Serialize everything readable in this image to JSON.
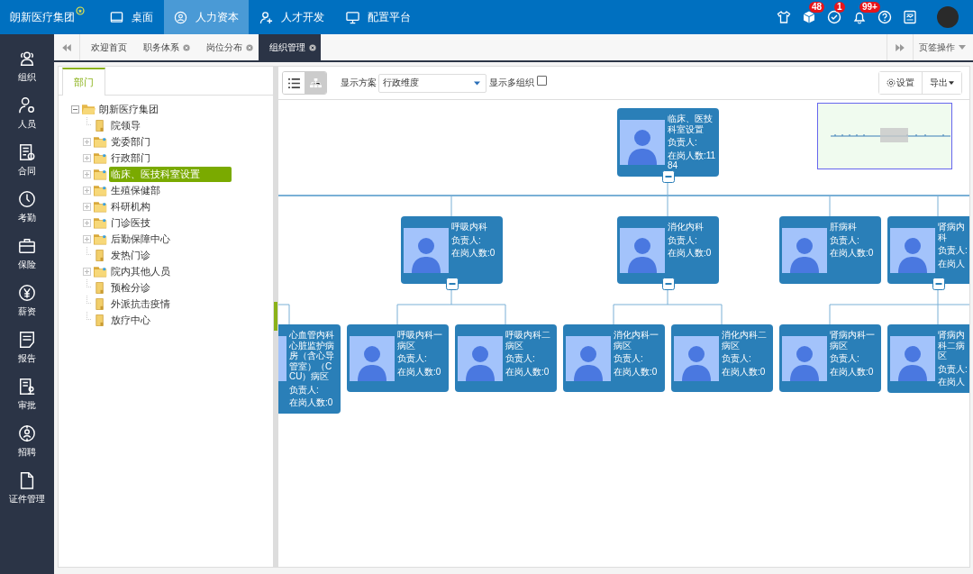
{
  "header": {
    "logo": "朗新医疗集团",
    "nav": [
      {
        "label": "桌面",
        "selected": false
      },
      {
        "label": "人力资本",
        "selected": true
      },
      {
        "label": "人才开发",
        "selected": false
      },
      {
        "label": "配置平台",
        "selected": false
      }
    ],
    "icons": [
      {
        "kind": "shirt"
      },
      {
        "kind": "cube",
        "badge": "48"
      },
      {
        "kind": "check",
        "badge": "1"
      },
      {
        "kind": "bell",
        "badge": "99+"
      },
      {
        "kind": "help"
      },
      {
        "kind": "report"
      },
      {
        "kind": "avatar"
      }
    ]
  },
  "sidebar": [
    "组织",
    "人员",
    "合同",
    "考勤",
    "保险",
    "薪资",
    "报告",
    "审批",
    "招聘",
    "证件管理"
  ],
  "tabs": {
    "items": [
      {
        "label": "欢迎首页",
        "closable": false,
        "selected": false
      },
      {
        "label": "职务体系",
        "closable": true,
        "selected": false
      },
      {
        "label": "岗位分布",
        "closable": true,
        "selected": false
      },
      {
        "label": "组织管理",
        "closable": true,
        "selected": true
      }
    ],
    "menu": "页签操作"
  },
  "tree": {
    "tab": "部门",
    "root": {
      "label": "朗新医疗集团",
      "expanded": true,
      "selected": false,
      "children": [
        {
          "label": "院领导",
          "kind": "leaf",
          "selected": false
        },
        {
          "label": "党委部门",
          "kind": "folder",
          "expanded": false,
          "selected": false
        },
        {
          "label": "行政部门",
          "kind": "folder",
          "expanded": false,
          "selected": false
        },
        {
          "label": "临床、医技科室设置",
          "kind": "folder",
          "expanded": false,
          "selected": true
        },
        {
          "label": "生殖保健部",
          "kind": "folder",
          "expanded": false,
          "selected": false
        },
        {
          "label": "科研机构",
          "kind": "folder",
          "expanded": false,
          "selected": false
        },
        {
          "label": "门诊医技",
          "kind": "folder",
          "expanded": false,
          "selected": false
        },
        {
          "label": "后勤保障中心",
          "kind": "folder",
          "expanded": false,
          "selected": false
        },
        {
          "label": "发热门诊",
          "kind": "leaf",
          "selected": false
        },
        {
          "label": "院内其他人员",
          "kind": "folder",
          "expanded": false,
          "selected": false
        },
        {
          "label": "预检分诊",
          "kind": "leaf",
          "selected": false
        },
        {
          "label": "外派抗击疫情",
          "kind": "leaf",
          "selected": false
        },
        {
          "label": "放疗中心",
          "kind": "leaf",
          "selected": false
        }
      ]
    }
  },
  "toolbar": {
    "views": [
      {
        "kind": "list",
        "selected": false
      },
      {
        "kind": "tree",
        "selected": true
      }
    ],
    "scheme_label": "显示方案",
    "scheme_value": "行政维度",
    "multi_label": "显示多组织",
    "multi_checked": false,
    "settings": "设置",
    "export": "导出"
  },
  "chart": {
    "levels": [
      [
        {
          "title": "临床、医技科室设置",
          "manager": "负责人:",
          "count": "在岗人数:1184",
          "expanded": true
        }
      ],
      [
        {
          "title": "呼吸内科",
          "manager": "负责人:",
          "count": "在岗人数:0",
          "expanded": true
        },
        {
          "title": "消化内科",
          "manager": "负责人:",
          "count": "在岗人数:0",
          "expanded": true
        },
        {
          "title": "肝病科",
          "manager": "负责人:",
          "count": "在岗人数:0"
        },
        {
          "title": "肾病内科",
          "manager": "负责人:",
          "count": "在岗人",
          "expanded": true
        }
      ],
      [
        {
          "title": "心血管内科心脏监护病房（含心导管室）（CCU）病区",
          "manager": "负责人:",
          "count": "在岗人数:0"
        },
        {
          "title": "呼吸内科一病区",
          "manager": "负责人:",
          "count": "在岗人数:0"
        },
        {
          "title": "呼吸内科二病区",
          "manager": "负责人:",
          "count": "在岗人数:0"
        },
        {
          "title": "消化内科一病区",
          "manager": "负责人:",
          "count": "在岗人数:0"
        },
        {
          "title": "消化内科二病区",
          "manager": "负责人:",
          "count": "在岗人数:0"
        },
        {
          "title": "肾病内科一病区",
          "manager": "负责人:",
          "count": "在岗人数:0"
        },
        {
          "title": "肾病内科二病区",
          "manager": "负责人:",
          "count": "在岗人"
        }
      ]
    ]
  }
}
